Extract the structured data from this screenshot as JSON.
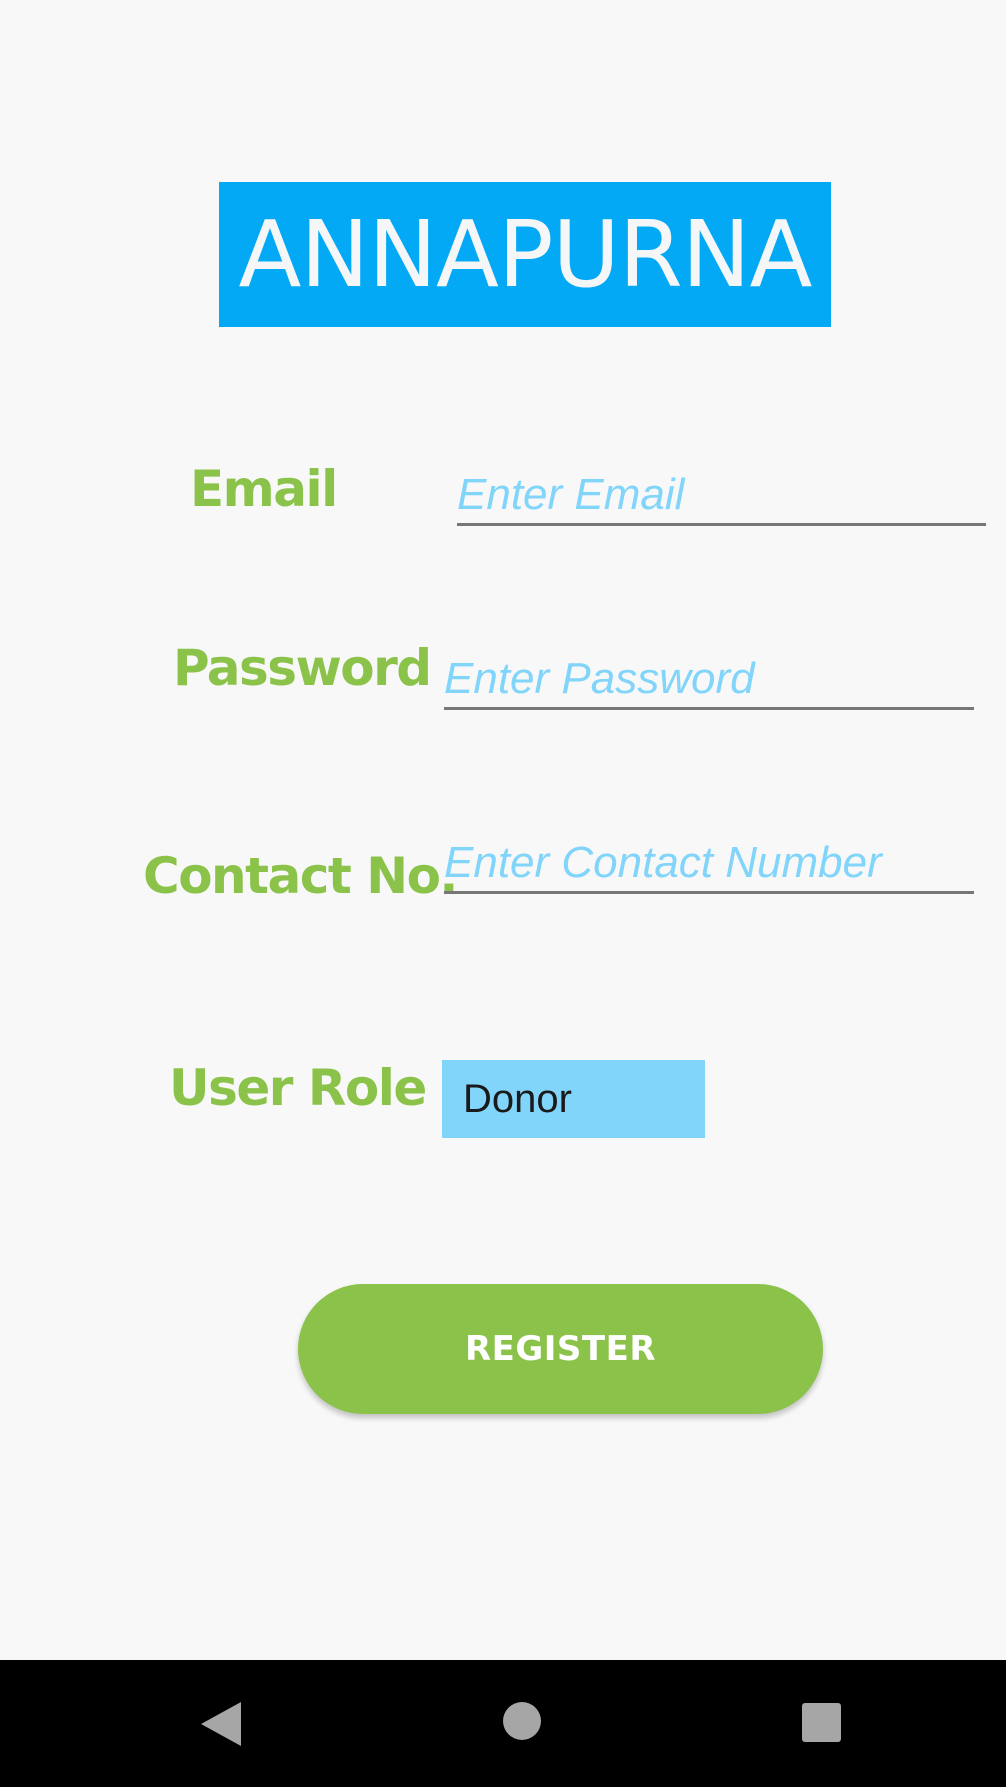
{
  "app": {
    "title": "ANNAPURNA"
  },
  "form": {
    "email": {
      "label": "Email",
      "placeholder": "Enter Email",
      "value": ""
    },
    "password": {
      "label": "Password",
      "placeholder": "Enter Password",
      "value": ""
    },
    "contact": {
      "label": "Contact No.",
      "placeholder": "Enter Contact Number",
      "value": ""
    },
    "user_role": {
      "label": "User Role",
      "selected": "Donor"
    },
    "register_label": "REGISTER"
  },
  "nav_bar": {
    "back": "back-icon",
    "home": "home-icon",
    "recent": "recent-apps-icon"
  },
  "colors": {
    "background": "#f8f8f9",
    "header_background": "#03a9f4",
    "header_text": "#f4f6f8",
    "label_green": "#8bc34a",
    "placeholder_blue": "#81d4fa",
    "input_underline": "#777777",
    "select_background": "#81d4fa",
    "button_green": "#8bc34a",
    "nav_bar": "#000000",
    "nav_icons": "#a6a6a6"
  }
}
